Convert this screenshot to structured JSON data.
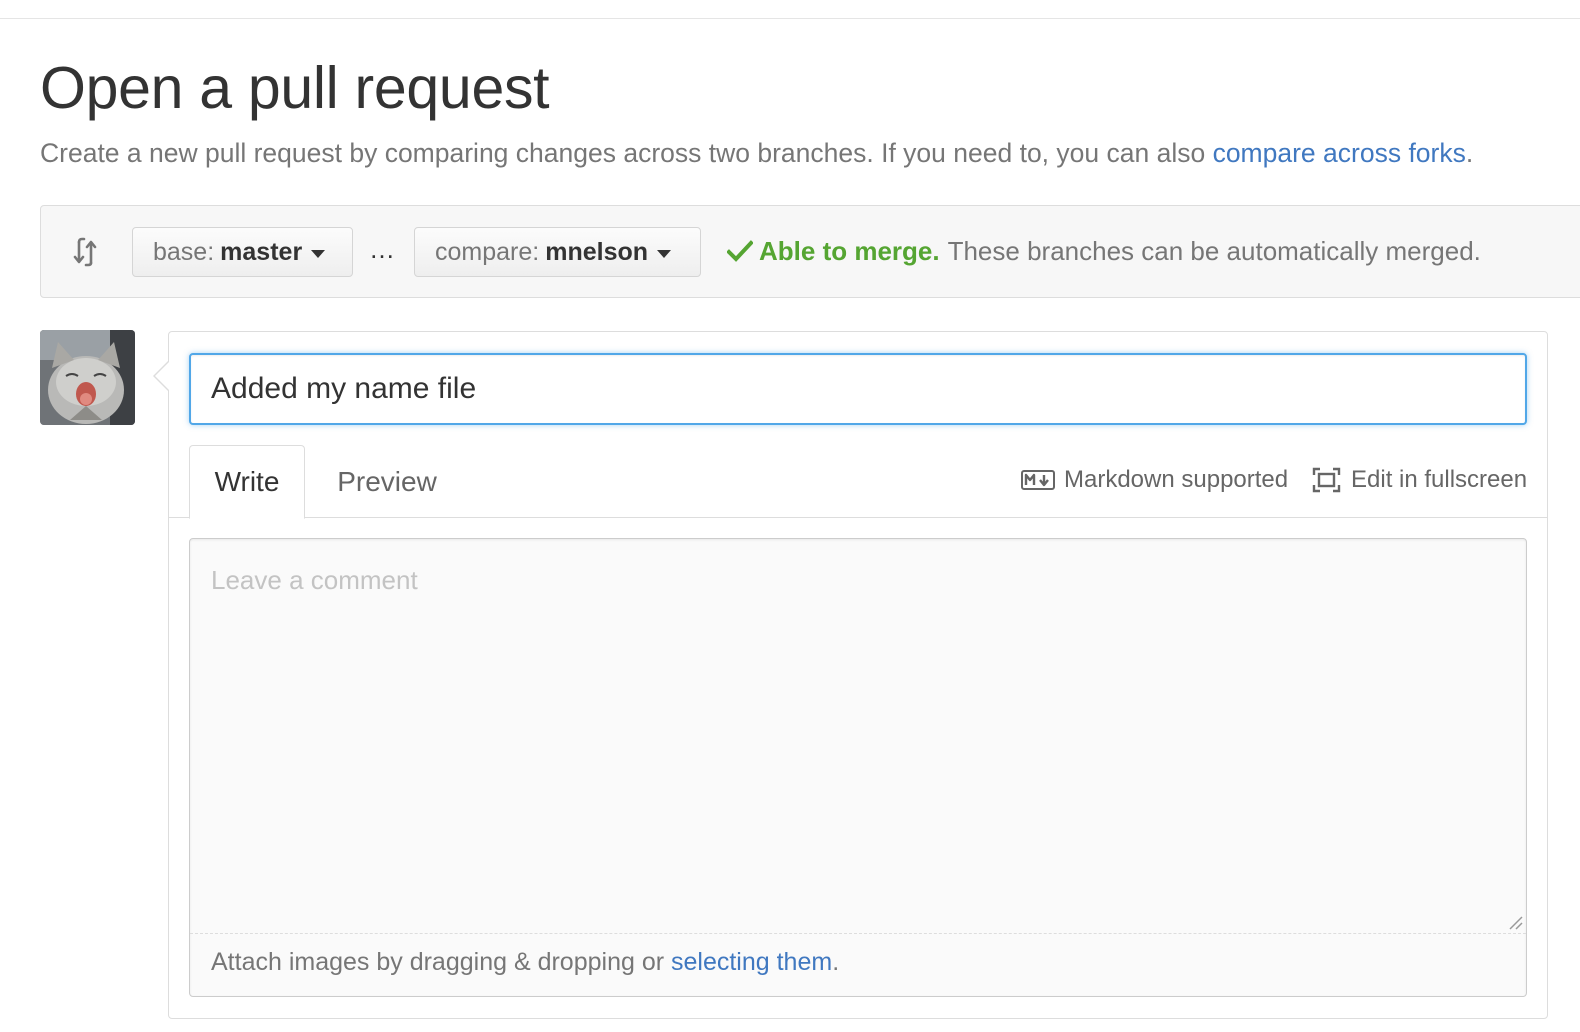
{
  "page": {
    "title": "Open a pull request",
    "subtitle_text": "Create a new pull request by comparing changes across two branches. If you need to, you can also ",
    "subtitle_link": "compare across forks",
    "subtitle_end": "."
  },
  "range": {
    "base_prefix": "base:",
    "base_branch": "master",
    "dots": "…",
    "compare_prefix": "compare:",
    "compare_branch": "mnelson",
    "merge_ok": "Able to merge.",
    "merge_detail": "These branches can be automatically merged.",
    "merge_color": "#55a532"
  },
  "composer": {
    "title_value": "Added my name file",
    "tabs": {
      "write": "Write",
      "preview": "Preview",
      "active": "write"
    },
    "markdown_label": "Markdown supported",
    "fullscreen_label": "Edit in fullscreen",
    "comment_placeholder": "Leave a comment",
    "attach_text": "Attach images by dragging & dropping or ",
    "attach_link": "selecting them",
    "attach_end": "."
  },
  "colors": {
    "link": "#4078c0",
    "focus": "#51a7e8",
    "border": "#dddddd"
  },
  "icons": {
    "compare": "git-compare-icon",
    "caret": "caret-down-icon",
    "check": "check-icon",
    "markdown": "markdown-icon",
    "fullscreen": "screen-full-icon",
    "resize": "resize-handle-icon"
  }
}
